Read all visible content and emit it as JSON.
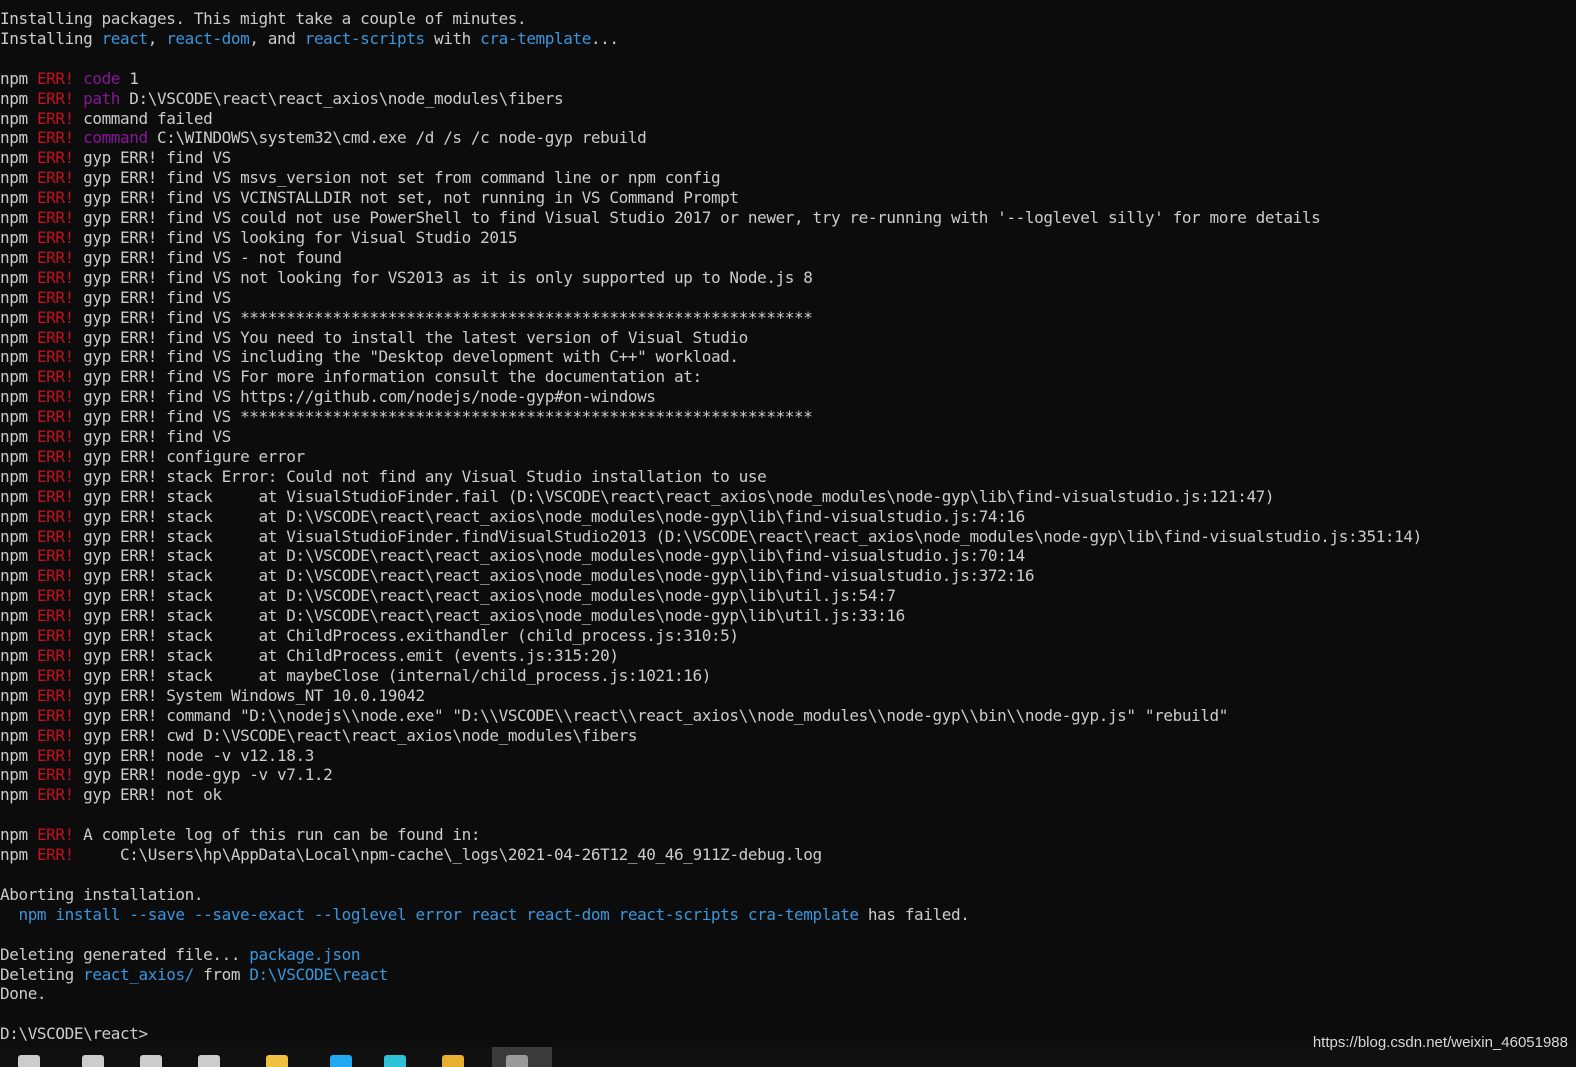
{
  "terminal": {
    "colors": {
      "background": "#0c0c0c",
      "default": "#cccccc",
      "red": "#c50f1f",
      "magenta": "#881798",
      "blue": "#3b78ff",
      "cyan": "#3a96dd"
    },
    "lines": [
      [
        {
          "t": "Installing packages. This might take a couple of minutes.",
          "c": "default"
        }
      ],
      [
        {
          "t": "Installing ",
          "c": "default"
        },
        {
          "t": "react",
          "c": "cyan"
        },
        {
          "t": ", ",
          "c": "default"
        },
        {
          "t": "react-dom",
          "c": "cyan"
        },
        {
          "t": ", and ",
          "c": "default"
        },
        {
          "t": "react-scripts",
          "c": "cyan"
        },
        {
          "t": " with ",
          "c": "default"
        },
        {
          "t": "cra-template",
          "c": "cyan"
        },
        {
          "t": "...",
          "c": "default"
        }
      ],
      [],
      [
        {
          "t": "npm ",
          "c": "default"
        },
        {
          "t": "ERR!",
          "c": "red"
        },
        {
          "t": " ",
          "c": "default"
        },
        {
          "t": "code",
          "c": "magenta"
        },
        {
          "t": " 1",
          "c": "default"
        }
      ],
      [
        {
          "t": "npm ",
          "c": "default"
        },
        {
          "t": "ERR!",
          "c": "red"
        },
        {
          "t": " ",
          "c": "default"
        },
        {
          "t": "path",
          "c": "magenta"
        },
        {
          "t": " D:\\VSCODE\\react\\react_axios\\node_modules\\fibers",
          "c": "default"
        }
      ],
      [
        {
          "t": "npm ",
          "c": "default"
        },
        {
          "t": "ERR!",
          "c": "red"
        },
        {
          "t": " command failed",
          "c": "default"
        }
      ],
      [
        {
          "t": "npm ",
          "c": "default"
        },
        {
          "t": "ERR!",
          "c": "red"
        },
        {
          "t": " ",
          "c": "default"
        },
        {
          "t": "command",
          "c": "magenta"
        },
        {
          "t": " C:\\WINDOWS\\system32\\cmd.exe /d /s /c node-gyp rebuild",
          "c": "default"
        }
      ],
      [
        {
          "t": "npm ",
          "c": "default"
        },
        {
          "t": "ERR!",
          "c": "red"
        },
        {
          "t": " gyp ERR! find VS",
          "c": "default"
        }
      ],
      [
        {
          "t": "npm ",
          "c": "default"
        },
        {
          "t": "ERR!",
          "c": "red"
        },
        {
          "t": " gyp ERR! find VS msvs_version not set from command line or npm config",
          "c": "default"
        }
      ],
      [
        {
          "t": "npm ",
          "c": "default"
        },
        {
          "t": "ERR!",
          "c": "red"
        },
        {
          "t": " gyp ERR! find VS VCINSTALLDIR not set, not running in VS Command Prompt",
          "c": "default"
        }
      ],
      [
        {
          "t": "npm ",
          "c": "default"
        },
        {
          "t": "ERR!",
          "c": "red"
        },
        {
          "t": " gyp ERR! find VS could not use PowerShell to find Visual Studio 2017 or newer, try re-running with '--loglevel silly' for more details",
          "c": "default"
        }
      ],
      [
        {
          "t": "npm ",
          "c": "default"
        },
        {
          "t": "ERR!",
          "c": "red"
        },
        {
          "t": " gyp ERR! find VS looking for Visual Studio 2015",
          "c": "default"
        }
      ],
      [
        {
          "t": "npm ",
          "c": "default"
        },
        {
          "t": "ERR!",
          "c": "red"
        },
        {
          "t": " gyp ERR! find VS - not found",
          "c": "default"
        }
      ],
      [
        {
          "t": "npm ",
          "c": "default"
        },
        {
          "t": "ERR!",
          "c": "red"
        },
        {
          "t": " gyp ERR! find VS not looking for VS2013 as it is only supported up to Node.js 8",
          "c": "default"
        }
      ],
      [
        {
          "t": "npm ",
          "c": "default"
        },
        {
          "t": "ERR!",
          "c": "red"
        },
        {
          "t": " gyp ERR! find VS",
          "c": "default"
        }
      ],
      [
        {
          "t": "npm ",
          "c": "default"
        },
        {
          "t": "ERR!",
          "c": "red"
        },
        {
          "t": " gyp ERR! find VS **************************************************************",
          "c": "default"
        }
      ],
      [
        {
          "t": "npm ",
          "c": "default"
        },
        {
          "t": "ERR!",
          "c": "red"
        },
        {
          "t": " gyp ERR! find VS You need to install the latest version of Visual Studio",
          "c": "default"
        }
      ],
      [
        {
          "t": "npm ",
          "c": "default"
        },
        {
          "t": "ERR!",
          "c": "red"
        },
        {
          "t": " gyp ERR! find VS including the \"Desktop development with C++\" workload.",
          "c": "default"
        }
      ],
      [
        {
          "t": "npm ",
          "c": "default"
        },
        {
          "t": "ERR!",
          "c": "red"
        },
        {
          "t": " gyp ERR! find VS For more information consult the documentation at:",
          "c": "default"
        }
      ],
      [
        {
          "t": "npm ",
          "c": "default"
        },
        {
          "t": "ERR!",
          "c": "red"
        },
        {
          "t": " gyp ERR! find VS https://github.com/nodejs/node-gyp#on-windows",
          "c": "default"
        }
      ],
      [
        {
          "t": "npm ",
          "c": "default"
        },
        {
          "t": "ERR!",
          "c": "red"
        },
        {
          "t": " gyp ERR! find VS **************************************************************",
          "c": "default"
        }
      ],
      [
        {
          "t": "npm ",
          "c": "default"
        },
        {
          "t": "ERR!",
          "c": "red"
        },
        {
          "t": " gyp ERR! find VS",
          "c": "default"
        }
      ],
      [
        {
          "t": "npm ",
          "c": "default"
        },
        {
          "t": "ERR!",
          "c": "red"
        },
        {
          "t": " gyp ERR! configure error",
          "c": "default"
        }
      ],
      [
        {
          "t": "npm ",
          "c": "default"
        },
        {
          "t": "ERR!",
          "c": "red"
        },
        {
          "t": " gyp ERR! stack Error: Could not find any Visual Studio installation to use",
          "c": "default"
        }
      ],
      [
        {
          "t": "npm ",
          "c": "default"
        },
        {
          "t": "ERR!",
          "c": "red"
        },
        {
          "t": " gyp ERR! stack     at VisualStudioFinder.fail (D:\\VSCODE\\react\\react_axios\\node_modules\\node-gyp\\lib\\find-visualstudio.js:121:47)",
          "c": "default"
        }
      ],
      [
        {
          "t": "npm ",
          "c": "default"
        },
        {
          "t": "ERR!",
          "c": "red"
        },
        {
          "t": " gyp ERR! stack     at D:\\VSCODE\\react\\react_axios\\node_modules\\node-gyp\\lib\\find-visualstudio.js:74:16",
          "c": "default"
        }
      ],
      [
        {
          "t": "npm ",
          "c": "default"
        },
        {
          "t": "ERR!",
          "c": "red"
        },
        {
          "t": " gyp ERR! stack     at VisualStudioFinder.findVisualStudio2013 (D:\\VSCODE\\react\\react_axios\\node_modules\\node-gyp\\lib\\find-visualstudio.js:351:14)",
          "c": "default"
        }
      ],
      [
        {
          "t": "npm ",
          "c": "default"
        },
        {
          "t": "ERR!",
          "c": "red"
        },
        {
          "t": " gyp ERR! stack     at D:\\VSCODE\\react\\react_axios\\node_modules\\node-gyp\\lib\\find-visualstudio.js:70:14",
          "c": "default"
        }
      ],
      [
        {
          "t": "npm ",
          "c": "default"
        },
        {
          "t": "ERR!",
          "c": "red"
        },
        {
          "t": " gyp ERR! stack     at D:\\VSCODE\\react\\react_axios\\node_modules\\node-gyp\\lib\\find-visualstudio.js:372:16",
          "c": "default"
        }
      ],
      [
        {
          "t": "npm ",
          "c": "default"
        },
        {
          "t": "ERR!",
          "c": "red"
        },
        {
          "t": " gyp ERR! stack     at D:\\VSCODE\\react\\react_axios\\node_modules\\node-gyp\\lib\\util.js:54:7",
          "c": "default"
        }
      ],
      [
        {
          "t": "npm ",
          "c": "default"
        },
        {
          "t": "ERR!",
          "c": "red"
        },
        {
          "t": " gyp ERR! stack     at D:\\VSCODE\\react\\react_axios\\node_modules\\node-gyp\\lib\\util.js:33:16",
          "c": "default"
        }
      ],
      [
        {
          "t": "npm ",
          "c": "default"
        },
        {
          "t": "ERR!",
          "c": "red"
        },
        {
          "t": " gyp ERR! stack     at ChildProcess.exithandler (child_process.js:310:5)",
          "c": "default"
        }
      ],
      [
        {
          "t": "npm ",
          "c": "default"
        },
        {
          "t": "ERR!",
          "c": "red"
        },
        {
          "t": " gyp ERR! stack     at ChildProcess.emit (events.js:315:20)",
          "c": "default"
        }
      ],
      [
        {
          "t": "npm ",
          "c": "default"
        },
        {
          "t": "ERR!",
          "c": "red"
        },
        {
          "t": " gyp ERR! stack     at maybeClose (internal/child_process.js:1021:16)",
          "c": "default"
        }
      ],
      [
        {
          "t": "npm ",
          "c": "default"
        },
        {
          "t": "ERR!",
          "c": "red"
        },
        {
          "t": " gyp ERR! System Windows_NT 10.0.19042",
          "c": "default"
        }
      ],
      [
        {
          "t": "npm ",
          "c": "default"
        },
        {
          "t": "ERR!",
          "c": "red"
        },
        {
          "t": " gyp ERR! command \"D:\\\\nodejs\\\\node.exe\" \"D:\\\\VSCODE\\\\react\\\\react_axios\\\\node_modules\\\\node-gyp\\\\bin\\\\node-gyp.js\" \"rebuild\"",
          "c": "default"
        }
      ],
      [
        {
          "t": "npm ",
          "c": "default"
        },
        {
          "t": "ERR!",
          "c": "red"
        },
        {
          "t": " gyp ERR! cwd D:\\VSCODE\\react\\react_axios\\node_modules\\fibers",
          "c": "default"
        }
      ],
      [
        {
          "t": "npm ",
          "c": "default"
        },
        {
          "t": "ERR!",
          "c": "red"
        },
        {
          "t": " gyp ERR! node -v v12.18.3",
          "c": "default"
        }
      ],
      [
        {
          "t": "npm ",
          "c": "default"
        },
        {
          "t": "ERR!",
          "c": "red"
        },
        {
          "t": " gyp ERR! node-gyp -v v7.1.2",
          "c": "default"
        }
      ],
      [
        {
          "t": "npm ",
          "c": "default"
        },
        {
          "t": "ERR!",
          "c": "red"
        },
        {
          "t": " gyp ERR! not ok",
          "c": "default"
        }
      ],
      [],
      [
        {
          "t": "npm ",
          "c": "default"
        },
        {
          "t": "ERR!",
          "c": "red"
        },
        {
          "t": " A complete log of this run can be found in:",
          "c": "default"
        }
      ],
      [
        {
          "t": "npm ",
          "c": "default"
        },
        {
          "t": "ERR!",
          "c": "red"
        },
        {
          "t": "     C:\\Users\\hp\\AppData\\Local\\npm-cache\\_logs\\2021-04-26T12_40_46_911Z-debug.log",
          "c": "default"
        }
      ],
      [],
      [
        {
          "t": "Aborting installation.",
          "c": "default"
        }
      ],
      [
        {
          "t": "  ",
          "c": "default"
        },
        {
          "t": "npm install --save --save-exact --loglevel error react react-dom react-scripts cra-template",
          "c": "cyan"
        },
        {
          "t": " has failed.",
          "c": "default"
        }
      ],
      [],
      [
        {
          "t": "Deleting generated file... ",
          "c": "default"
        },
        {
          "t": "package.json",
          "c": "cyan"
        }
      ],
      [
        {
          "t": "Deleting ",
          "c": "default"
        },
        {
          "t": "react_axios/",
          "c": "cyan"
        },
        {
          "t": " from ",
          "c": "default"
        },
        {
          "t": "D:\\VSCODE\\react",
          "c": "cyan"
        }
      ],
      [
        {
          "t": "Done.",
          "c": "default"
        }
      ],
      [],
      [
        {
          "t": "D:\\VSCODE\\react>",
          "c": "default"
        }
      ]
    ]
  },
  "taskbar": {
    "icons": [
      {
        "name": "windows-start-icon",
        "color": "#cccccc"
      },
      {
        "name": "search-icon",
        "color": "#cccccc"
      },
      {
        "name": "cortana-icon",
        "color": "#cccccc"
      },
      {
        "name": "task-view-icon",
        "color": "#cccccc"
      },
      {
        "name": "file-explorer-folder-icon",
        "color": "#f0c040"
      },
      {
        "name": "vscode-icon",
        "color": "#23a9f2"
      },
      {
        "name": "edge-browser-icon",
        "color": "#2fc1d8"
      },
      {
        "name": "folder-icon",
        "color": "#e8b030"
      },
      {
        "name": "terminal-icon",
        "color": "#9a9a9a"
      }
    ]
  },
  "watermark": "https://blog.csdn.net/weixin_46051988"
}
